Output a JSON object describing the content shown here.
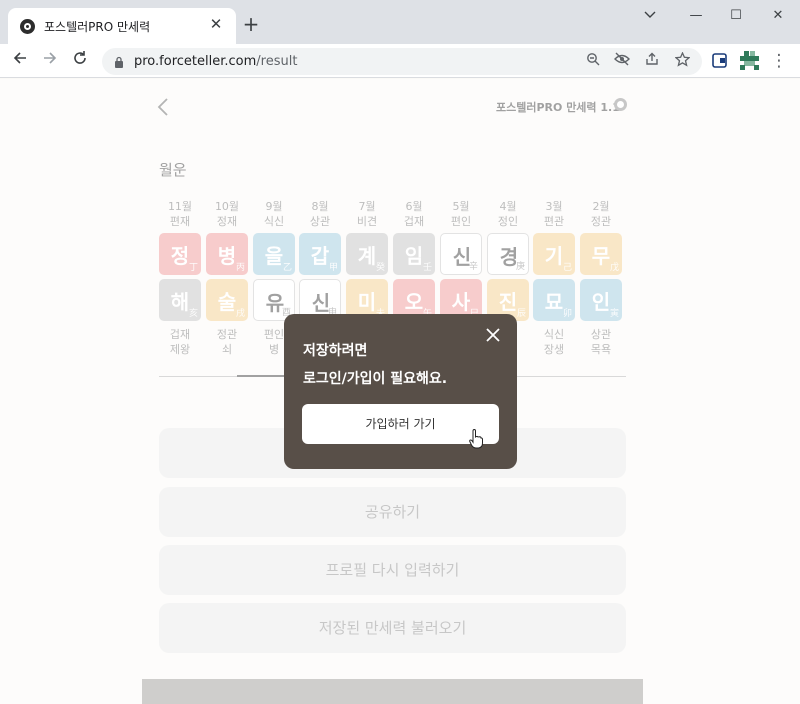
{
  "browser": {
    "tab_title": "포스텔러PRO 만세력",
    "tab_close": "✕",
    "new_tab": "+",
    "url_domain": "pro.forceteller.com",
    "url_path": "/result",
    "win_minimize": "—",
    "win_maximize": "☐",
    "win_close": "✕",
    "menu": "⋮"
  },
  "header": {
    "brand": "포스텔러PRO 만세력 1.1"
  },
  "section": {
    "title": "월운"
  },
  "months": [
    {
      "month": "11월",
      "god": "편재",
      "top": "정",
      "top_small": "丁",
      "top_color": "#f0a3a3",
      "bottom": "해",
      "bottom_small": "亥",
      "bottom_color": "#c8c8c8",
      "b1": "겁재",
      "b2": "제왕"
    },
    {
      "month": "10월",
      "god": "정재",
      "top": "병",
      "top_small": "丙",
      "top_color": "#f0a3a3",
      "bottom": "술",
      "bottom_small": "戌",
      "bottom_color": "#f5d39a",
      "b1": "정관",
      "b2": "쇠"
    },
    {
      "month": "9월",
      "god": "식신",
      "top": "을",
      "top_small": "乙",
      "top_color": "#a8cfe0",
      "bottom": "유",
      "bottom_small": "酉",
      "bottom_color": "#ffffff",
      "b1": "편인",
      "b2": "병"
    },
    {
      "month": "8월",
      "god": "상관",
      "top": "갑",
      "top_small": "甲",
      "top_color": "#a8cfe0",
      "bottom": "신",
      "bottom_small": "申",
      "bottom_color": "#ffffff",
      "b1": "",
      "b2": ""
    },
    {
      "month": "7월",
      "god": "비견",
      "top": "계",
      "top_small": "癸",
      "top_color": "#c8c8c8",
      "bottom": "미",
      "bottom_small": "未",
      "bottom_color": "#f5d39a",
      "b1": "",
      "b2": ""
    },
    {
      "month": "6월",
      "god": "겁재",
      "top": "임",
      "top_small": "壬",
      "top_color": "#c8c8c8",
      "bottom": "오",
      "bottom_small": "午",
      "bottom_color": "#f0a3a3",
      "b1": "",
      "b2": ""
    },
    {
      "month": "5월",
      "god": "편인",
      "top": "신",
      "top_small": "辛",
      "top_color": "#ffffff",
      "bottom": "사",
      "bottom_small": "巳",
      "bottom_color": "#f0a3a3",
      "b1": "",
      "b2": ""
    },
    {
      "month": "4월",
      "god": "정인",
      "top": "경",
      "top_small": "庚",
      "top_color": "#ffffff",
      "bottom": "진",
      "bottom_small": "辰",
      "bottom_color": "#f5d39a",
      "b1": "",
      "b2": ""
    },
    {
      "month": "3월",
      "god": "편관",
      "top": "기",
      "top_small": "己",
      "top_color": "#f5d39a",
      "bottom": "묘",
      "bottom_small": "卯",
      "bottom_color": "#a8cfe0",
      "b1": "식신",
      "b2": "장생"
    },
    {
      "month": "2월",
      "god": "정관",
      "top": "무",
      "top_small": "戊",
      "top_color": "#f5d39a",
      "bottom": "인",
      "bottom_small": "寅",
      "bottom_color": "#a8cfe0",
      "b1": "상관",
      "b2": "목욕"
    }
  ],
  "buttons": {
    "share": "공유하기",
    "re_enter": "프로필 다시 입력하기",
    "load_saved": "저장된 만세력 불러오기"
  },
  "modal": {
    "line1": "저장하려면",
    "line2": "로그인/가입이 필요해요.",
    "button": "가입하러 가기"
  }
}
